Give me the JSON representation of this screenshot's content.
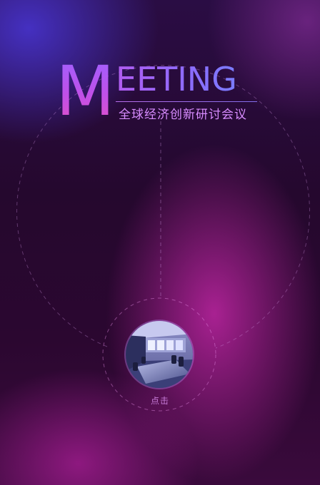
{
  "colors": {
    "accent_purple": "#b15cf0",
    "accent_magenta": "#d03ac0",
    "background_dark": "#25082e",
    "subtitle_color": "#d88cff"
  },
  "title": {
    "initial": "M",
    "rest": "EETING"
  },
  "subtitle": "全球经济创新研讨会议",
  "entry": {
    "image_icon": "meeting-room-photo",
    "label": "点击"
  }
}
